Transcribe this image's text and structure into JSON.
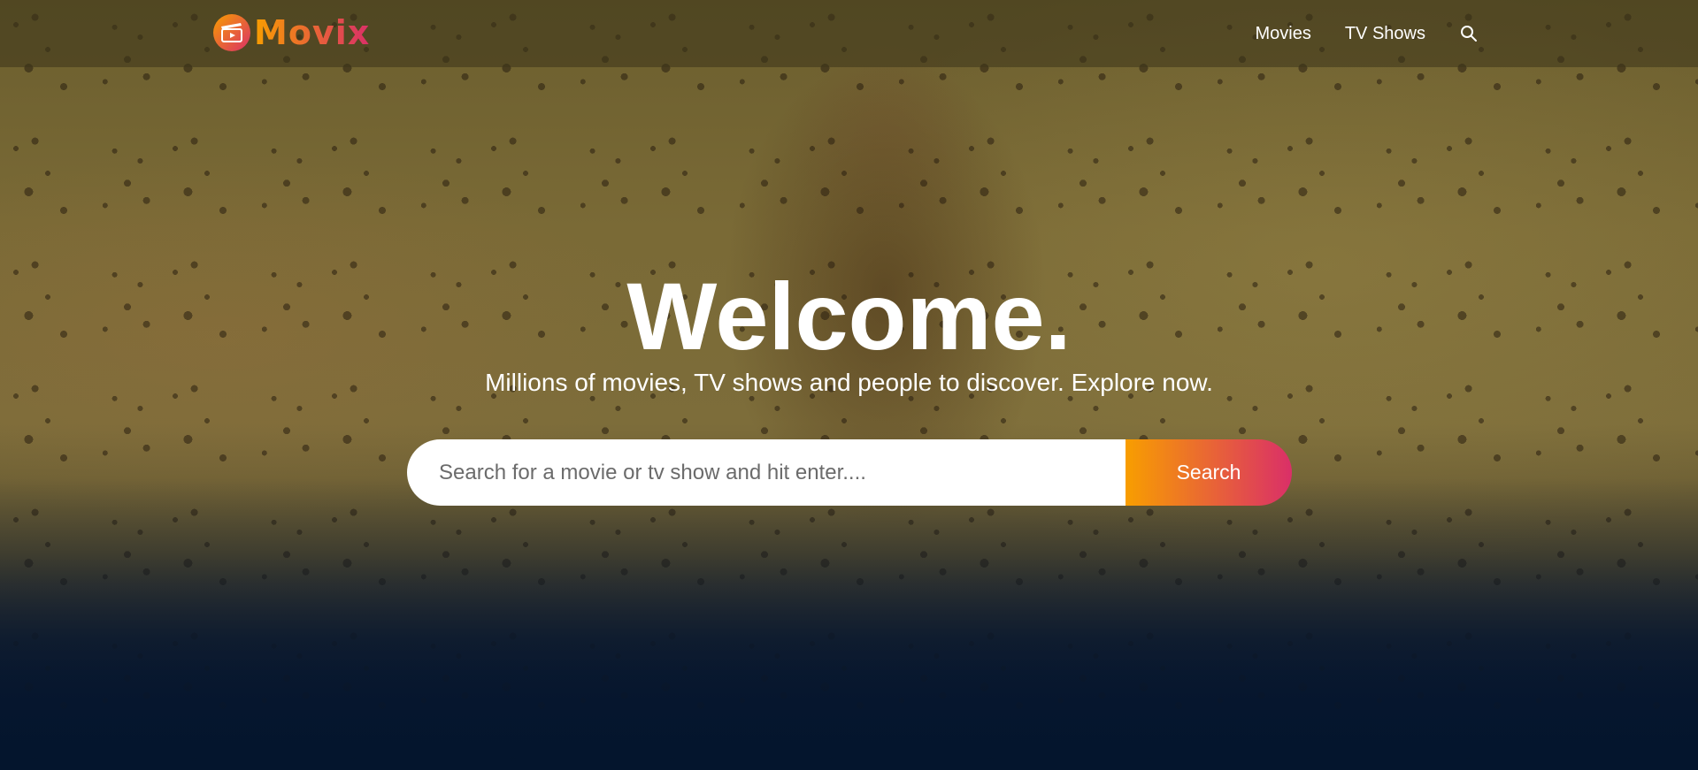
{
  "colors": {
    "accent_start": "#f89e00",
    "accent_end": "#da2f68",
    "background": "#04152d",
    "header_bg": "#3c3419"
  },
  "header": {
    "logo": {
      "icon": "clapperboard-play-icon",
      "text": "Movix"
    },
    "nav": {
      "movies_label": "Movies",
      "tv_shows_label": "TV Shows",
      "search_icon": "search-icon"
    }
  },
  "hero": {
    "title": "Welcome.",
    "subtitle": "Millions of movies, TV shows and people to discover. Explore now.",
    "search": {
      "placeholder": "Search for a movie or tv show and hit enter....",
      "value": "",
      "button_label": "Search"
    }
  }
}
